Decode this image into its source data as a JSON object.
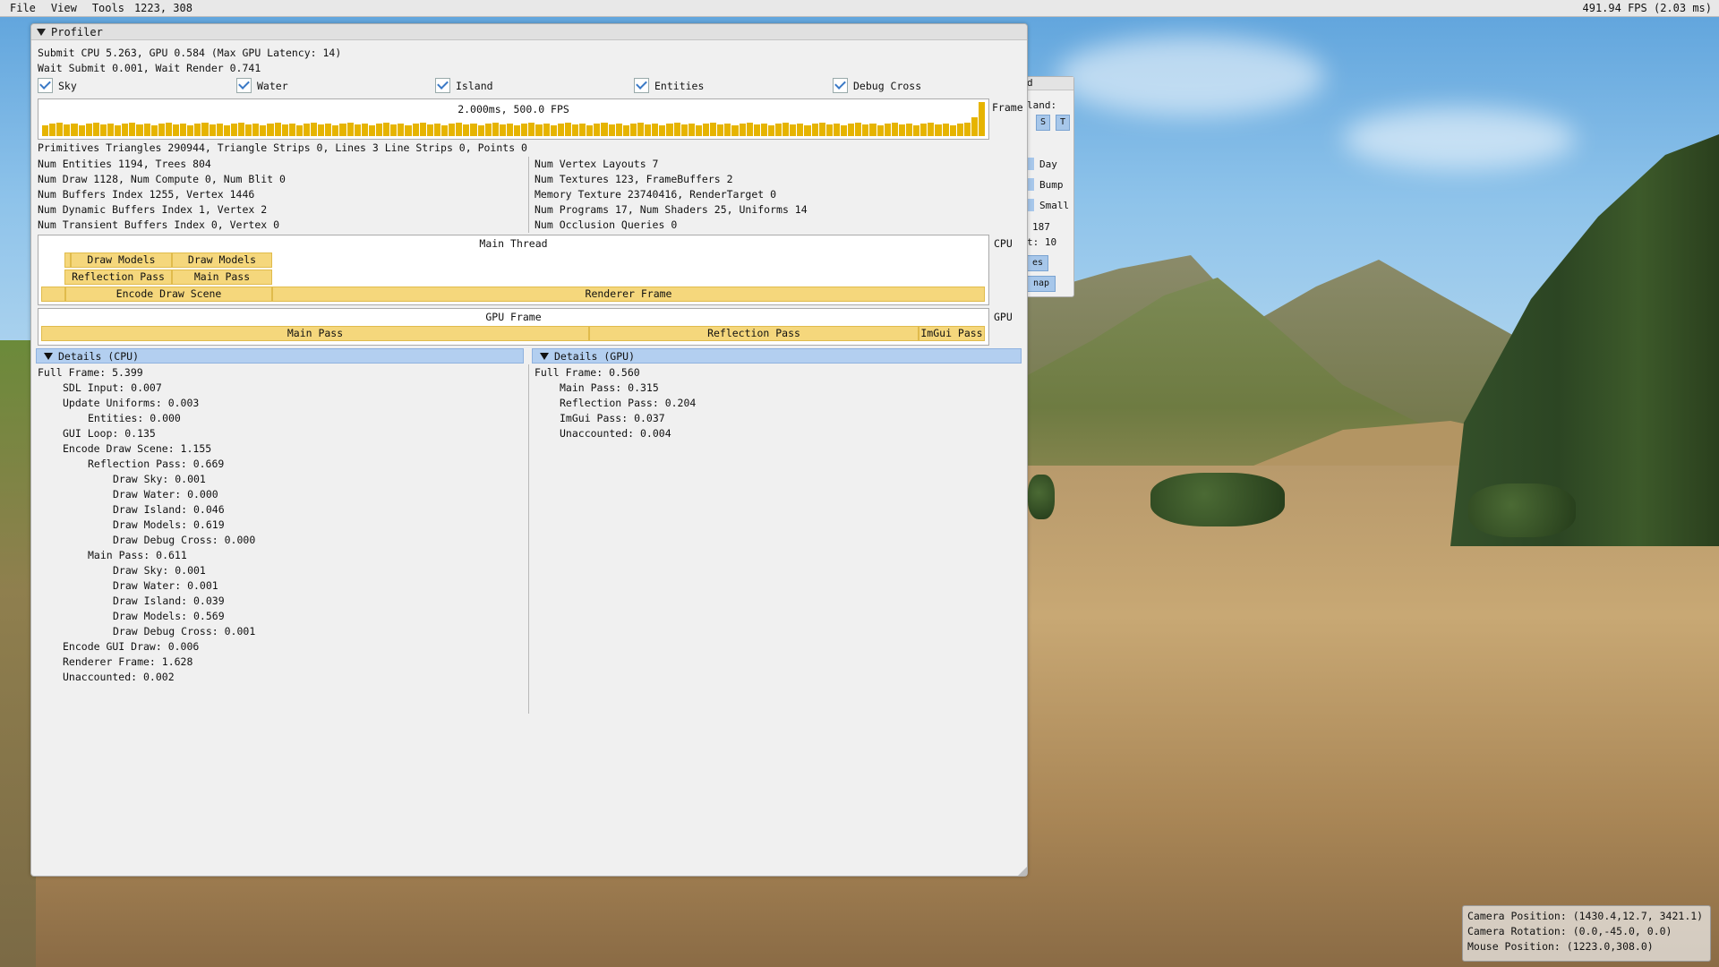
{
  "menubar": {
    "items": [
      "File",
      "View",
      "Tools"
    ],
    "mouse_coords": "1223, 308",
    "fps": "491.94 FPS (2.03 ms)"
  },
  "bg_window": {
    "title_fragment": "d",
    "frame_label": "Frame",
    "island_label": "land:",
    "btn_s": "S",
    "btn_t": "T",
    "day": "Day",
    "bump": "Bump",
    "small": "Small",
    "val_187": "187",
    "t10": "t: 10",
    "es": "es",
    "map": "nap"
  },
  "profiler": {
    "title": "Profiler",
    "submit_line": "Submit CPU 5.263, GPU 0.584 (Max GPU Latency: 14)",
    "wait_line": "Wait Submit 0.001, Wait Render 0.741",
    "checkboxes": [
      "Sky",
      "Water",
      "Island",
      "Entities",
      "Debug Cross"
    ],
    "frame_graph": {
      "label": "2.000ms, 500.0 FPS",
      "side_label": "Frame"
    },
    "primitives": "Primitives Triangles 290944, Triangle Strips 0, Lines 3 Line Strips 0, Points 0",
    "stats_left": [
      "Num Entities 1194, Trees 804",
      "Num Draw 1128, Num Compute 0, Num Blit 0",
      "Num Buffers Index 1255, Vertex 1446",
      "Num Dynamic Buffers Index 1, Vertex 2",
      "Num Transient Buffers Index 0, Vertex 0"
    ],
    "stats_right": [
      "Num Vertex Layouts 7",
      "Num Textures 123, FrameBuffers 2",
      "Memory Texture 23740416, RenderTarget 0",
      "Num Programs 17, Num Shaders 25, Uniforms 14",
      "Num Occlusion Queries 0"
    ],
    "cpu_timeline": {
      "title": "Main Thread",
      "side_label": "CPU",
      "blocks": {
        "draw_models_1": "Draw Models",
        "draw_models_2": "Draw Models",
        "reflection_pass": "Reflection Pass",
        "main_pass": "Main Pass",
        "encode_draw_scene": "Encode Draw Scene",
        "renderer_frame": "Renderer Frame"
      }
    },
    "gpu_timeline": {
      "title": "GPU Frame",
      "side_label": "GPU",
      "blocks": {
        "main_pass": "Main Pass",
        "reflection_pass": "Reflection Pass",
        "imgui_pass": "ImGui Pass"
      }
    },
    "details_cpu": {
      "header": "Details (CPU)",
      "rows": [
        {
          "text": "Full Frame: 5.399",
          "indent": 0
        },
        {
          "text": "SDL Input: 0.007",
          "indent": 1
        },
        {
          "text": "Update Uniforms: 0.003",
          "indent": 1
        },
        {
          "text": "Entities: 0.000",
          "indent": 2
        },
        {
          "text": "GUI Loop: 0.135",
          "indent": 1
        },
        {
          "text": "Encode Draw Scene: 1.155",
          "indent": 1
        },
        {
          "text": "Reflection Pass: 0.669",
          "indent": 2
        },
        {
          "text": "Draw Sky: 0.001",
          "indent": 3
        },
        {
          "text": "Draw Water: 0.000",
          "indent": 3
        },
        {
          "text": "Draw Island: 0.046",
          "indent": 3
        },
        {
          "text": "Draw Models: 0.619",
          "indent": 3
        },
        {
          "text": "Draw Debug Cross: 0.000",
          "indent": 3
        },
        {
          "text": "Main Pass: 0.611",
          "indent": 2
        },
        {
          "text": "Draw Sky: 0.001",
          "indent": 3
        },
        {
          "text": "Draw Water: 0.001",
          "indent": 3
        },
        {
          "text": "Draw Island: 0.039",
          "indent": 3
        },
        {
          "text": "Draw Models: 0.569",
          "indent": 3
        },
        {
          "text": "Draw Debug Cross: 0.001",
          "indent": 3
        },
        {
          "text": "Encode GUI Draw: 0.006",
          "indent": 1
        },
        {
          "text": "Renderer Frame: 1.628",
          "indent": 1
        },
        {
          "text": "Unaccounted: 0.002",
          "indent": 1
        }
      ]
    },
    "details_gpu": {
      "header": "Details (GPU)",
      "rows": [
        {
          "text": "Full Frame: 0.560",
          "indent": 0
        },
        {
          "text": "Main Pass: 0.315",
          "indent": 1
        },
        {
          "text": "Reflection Pass: 0.204",
          "indent": 1
        },
        {
          "text": "ImGui Pass: 0.037",
          "indent": 1
        },
        {
          "text": "Unaccounted: 0.004",
          "indent": 1
        }
      ]
    }
  },
  "overlay": {
    "camera_position": "Camera Position: (1430.4,12.7, 3421.1)",
    "camera_rotation": "Camera Rotation: (0.0,-45.0, 0.0)",
    "mouse_position": "Mouse Position: (1223.0,308.0)"
  },
  "colors": {
    "bar_fill": "#e6b400",
    "timeline_block": "#f5d77c",
    "details_header": "#b3cff0",
    "checkbox_tick": "#3a79c6"
  }
}
